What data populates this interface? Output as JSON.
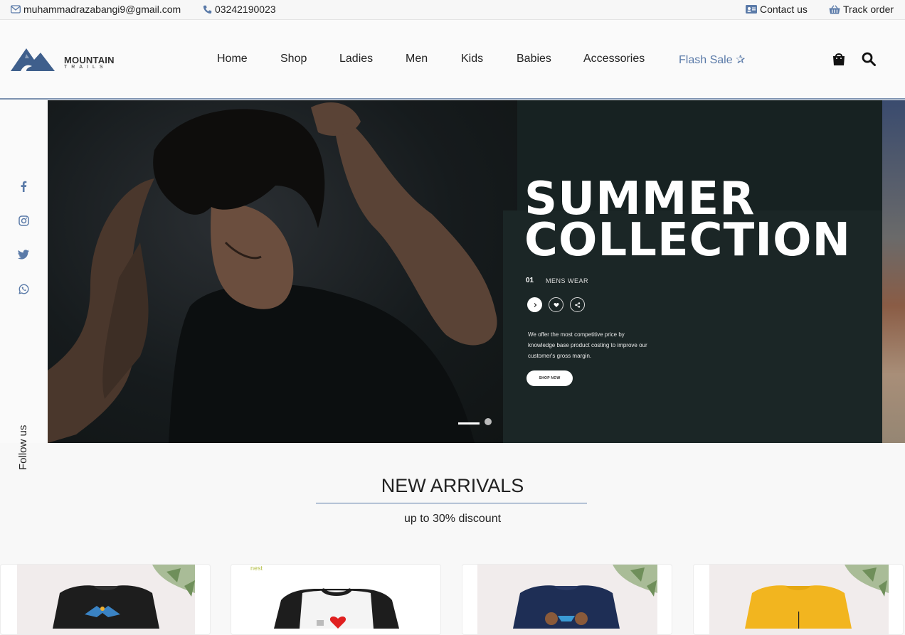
{
  "topbar": {
    "email": "muhammadrazabangi9@gmail.com",
    "phone": "03242190023",
    "contact_label": "Contact us",
    "track_label": "Track order"
  },
  "logo": {
    "name": "MOUNTAIN",
    "sub": "TRAILS"
  },
  "nav": {
    "items": [
      "Home",
      "Shop",
      "Ladies",
      "Men",
      "Kids",
      "Babies",
      "Accessories"
    ],
    "flash": "Flash Sale ✰"
  },
  "side": {
    "follow_label": "Follow us"
  },
  "hero": {
    "title_line1": "SUMMER",
    "title_line2": "COLLECTION",
    "number": "01",
    "category": "MENS WEAR",
    "description": "We offer the most competitive price by knowledge base product costing to improve our customer's gross margin.",
    "cta": "SHOP NOW"
  },
  "arrivals": {
    "title": "NEW ARRIVALS",
    "subtitle": "up to 30% discount",
    "card2_tag": "nest"
  },
  "colors": {
    "accent": "#5a7aa8",
    "hero_bg": "#172222"
  }
}
